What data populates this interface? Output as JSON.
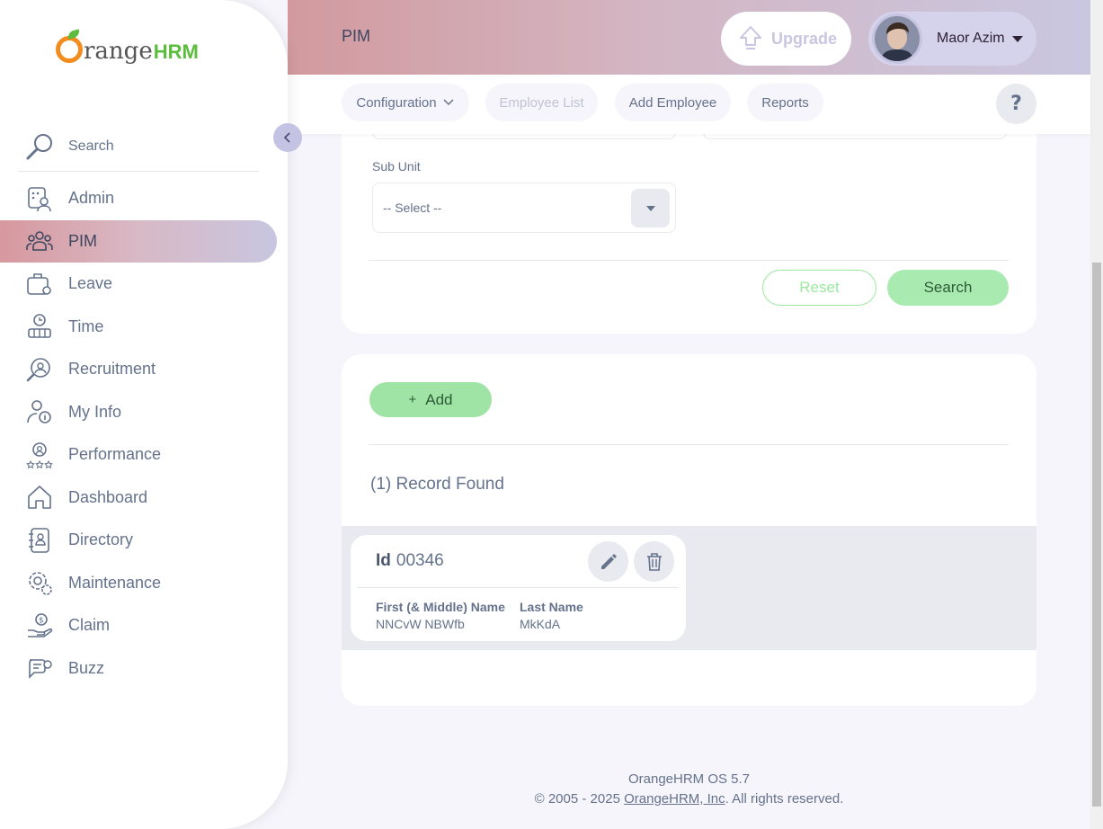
{
  "brand": {
    "name_part1": "range",
    "name_part2": "HRM"
  },
  "sidebar": {
    "search_label": "Search",
    "items": [
      {
        "label": "Admin",
        "icon": "admin-icon",
        "active": false
      },
      {
        "label": "PIM",
        "icon": "pim-icon",
        "active": true
      },
      {
        "label": "Leave",
        "icon": "leave-icon",
        "active": false
      },
      {
        "label": "Time",
        "icon": "time-icon",
        "active": false
      },
      {
        "label": "Recruitment",
        "icon": "recruitment-icon",
        "active": false
      },
      {
        "label": "My Info",
        "icon": "my-info-icon",
        "active": false
      },
      {
        "label": "Performance",
        "icon": "performance-icon",
        "active": false
      },
      {
        "label": "Dashboard",
        "icon": "dashboard-icon",
        "active": false
      },
      {
        "label": "Directory",
        "icon": "directory-icon",
        "active": false
      },
      {
        "label": "Maintenance",
        "icon": "maintenance-icon",
        "active": false
      },
      {
        "label": "Claim",
        "icon": "claim-icon",
        "active": false
      },
      {
        "label": "Buzz",
        "icon": "buzz-icon",
        "active": false
      }
    ]
  },
  "header": {
    "title": "PIM",
    "upgrade_label": "Upgrade",
    "user_name": "Maor Azim"
  },
  "subnav": {
    "tabs": [
      {
        "label": "Configuration",
        "has_dropdown": true,
        "active": false
      },
      {
        "label": "Employee List",
        "active": true
      },
      {
        "label": "Add Employee",
        "active": false
      },
      {
        "label": "Reports",
        "active": false
      }
    ],
    "help_label": "?"
  },
  "filter": {
    "sub_unit_label": "Sub Unit",
    "sub_unit_value": "-- Select --",
    "reset_label": "Reset",
    "search_label": "Search"
  },
  "results": {
    "add_label": "Add",
    "record_count": "(1) Record Found",
    "rows": [
      {
        "id_label": "Id",
        "id_value": "00346",
        "first_middle_header": "First (& Middle) Name",
        "first_middle_value": "NNCvW NBWfb",
        "last_header": "Last Name",
        "last_value": "MkKdA"
      }
    ]
  },
  "footer": {
    "version": "OrangeHRM OS 5.7",
    "copyright_prefix": "© 2005 - 2025 ",
    "company_link": "OrangeHRM, Inc",
    "copyright_suffix": ". All rights reserved."
  },
  "colors": {
    "accent_green": "#a9eab0",
    "brand_orange": "#f28c1e",
    "text": "#64728c"
  }
}
